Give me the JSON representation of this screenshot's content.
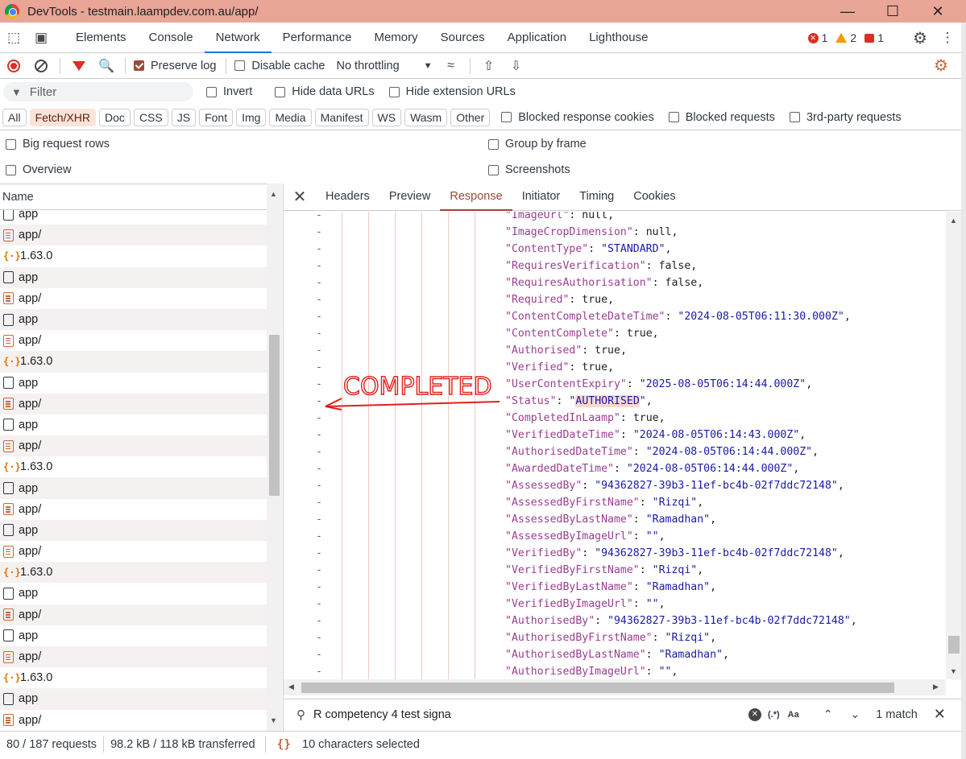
{
  "window": {
    "title": "DevTools - testmain.laampdev.com.au/app/"
  },
  "main_tabs": [
    "Elements",
    "Console",
    "Network",
    "Performance",
    "Memory",
    "Sources",
    "Application",
    "Lighthouse"
  ],
  "active_main_tab": "Network",
  "counters": {
    "errors": "1",
    "warnings": "2",
    "issues": "1"
  },
  "toolbar": {
    "preserve_log": "Preserve log",
    "disable_cache": "Disable cache",
    "throttling": "No throttling"
  },
  "filter": {
    "placeholder": "Filter",
    "invert": "Invert",
    "hide_data_urls": "Hide data URLs",
    "hide_extension_urls": "Hide extension URLs"
  },
  "type_chips": [
    "All",
    "Fetch/XHR",
    "Doc",
    "CSS",
    "JS",
    "Font",
    "Img",
    "Media",
    "Manifest",
    "WS",
    "Wasm",
    "Other"
  ],
  "active_chip": "Fetch/XHR",
  "chip_checks": {
    "blocked_cookies": "Blocked response cookies",
    "blocked_requests": "Blocked requests",
    "third_party": "3rd-party requests"
  },
  "options": {
    "big_rows": "Big request rows",
    "group_by_frame": "Group by frame",
    "overview": "Overview",
    "screenshots": "Screenshots"
  },
  "request_list": {
    "header": "Name",
    "rows": [
      {
        "icon": "doc",
        "name": "app"
      },
      {
        "icon": "lines",
        "name": "app/"
      },
      {
        "icon": "json",
        "name": "1.63.0"
      },
      {
        "icon": "doc",
        "name": "app"
      },
      {
        "icon": "lines",
        "name": "app/"
      },
      {
        "icon": "doc",
        "name": "app"
      },
      {
        "icon": "lines",
        "name": "app/"
      },
      {
        "icon": "json",
        "name": "1.63.0"
      },
      {
        "icon": "doc",
        "name": "app"
      },
      {
        "icon": "lines",
        "name": "app/"
      },
      {
        "icon": "doc",
        "name": "app"
      },
      {
        "icon": "lines",
        "name": "app/"
      },
      {
        "icon": "json",
        "name": "1.63.0"
      },
      {
        "icon": "doc",
        "name": "app"
      },
      {
        "icon": "lines",
        "name": "app/"
      },
      {
        "icon": "doc",
        "name": "app"
      },
      {
        "icon": "lines",
        "name": "app/"
      },
      {
        "icon": "json",
        "name": "1.63.0"
      },
      {
        "icon": "doc",
        "name": "app"
      },
      {
        "icon": "lines",
        "name": "app/"
      },
      {
        "icon": "doc",
        "name": "app"
      },
      {
        "icon": "lines",
        "name": "app/"
      },
      {
        "icon": "json",
        "name": "1.63.0"
      },
      {
        "icon": "doc",
        "name": "app"
      },
      {
        "icon": "lines",
        "name": "app/"
      }
    ]
  },
  "detail_tabs": [
    "Headers",
    "Preview",
    "Response",
    "Initiator",
    "Timing",
    "Cookies"
  ],
  "active_detail_tab": "Response",
  "response_lines": [
    {
      "key": "\"ImageUrl\"",
      "value": "null",
      "type": "p"
    },
    {
      "key": "\"ImageCropDimension\"",
      "value": "null",
      "type": "p"
    },
    {
      "key": "\"ContentType\"",
      "value": "\"STANDARD\"",
      "type": "s"
    },
    {
      "key": "\"RequiresVerification\"",
      "value": "false",
      "type": "p"
    },
    {
      "key": "\"RequiresAuthorisation\"",
      "value": "false",
      "type": "p"
    },
    {
      "key": "\"Required\"",
      "value": "true",
      "type": "p"
    },
    {
      "key": "\"ContentCompleteDateTime\"",
      "value": "\"2024-08-05T06:11:30.000Z\"",
      "type": "s"
    },
    {
      "key": "\"ContentComplete\"",
      "value": "true",
      "type": "p"
    },
    {
      "key": "\"Authorised\"",
      "value": "true",
      "type": "p"
    },
    {
      "key": "\"Verified\"",
      "value": "true",
      "type": "p"
    },
    {
      "key": "\"UserContentExpiry\"",
      "value": "\"2025-08-05T06:14:44.000Z\"",
      "type": "s"
    },
    {
      "key": "\"Status\"",
      "value": "\"AUTHORISED\"",
      "type": "hl"
    },
    {
      "key": "\"CompletedInLaamp\"",
      "value": "true",
      "type": "p"
    },
    {
      "key": "\"VerifiedDateTime\"",
      "value": "\"2024-08-05T06:14:43.000Z\"",
      "type": "s"
    },
    {
      "key": "\"AuthorisedDateTime\"",
      "value": "\"2024-08-05T06:14:44.000Z\"",
      "type": "s"
    },
    {
      "key": "\"AwardedDateTime\"",
      "value": "\"2024-08-05T06:14:44.000Z\"",
      "type": "s"
    },
    {
      "key": "\"AssessedBy\"",
      "value": "\"94362827-39b3-11ef-bc4b-02f7ddc72148\"",
      "type": "s"
    },
    {
      "key": "\"AssessedByFirstName\"",
      "value": "\"Rizqi\"",
      "type": "s"
    },
    {
      "key": "\"AssessedByLastName\"",
      "value": "\"Ramadhan\"",
      "type": "s"
    },
    {
      "key": "\"AssessedByImageUrl\"",
      "value": "\"\"",
      "type": "s"
    },
    {
      "key": "\"VerifiedBy\"",
      "value": "\"94362827-39b3-11ef-bc4b-02f7ddc72148\"",
      "type": "s"
    },
    {
      "key": "\"VerifiedByFirstName\"",
      "value": "\"Rizqi\"",
      "type": "s"
    },
    {
      "key": "\"VerifiedByLastName\"",
      "value": "\"Ramadhan\"",
      "type": "s"
    },
    {
      "key": "\"VerifiedByImageUrl\"",
      "value": "\"\"",
      "type": "s"
    },
    {
      "key": "\"AuthorisedBy\"",
      "value": "\"94362827-39b3-11ef-bc4b-02f7ddc72148\"",
      "type": "s"
    },
    {
      "key": "\"AuthorisedByFirstName\"",
      "value": "\"Rizqi\"",
      "type": "s"
    },
    {
      "key": "\"AuthorisedByLastName\"",
      "value": "\"Ramadhan\"",
      "type": "s"
    },
    {
      "key": "\"AuthorisedByImageUrl\"",
      "value": "\"\"",
      "type": "s"
    }
  ],
  "annotation": {
    "text": "COMPLETED",
    "color": "#e0201a"
  },
  "search": {
    "query": "R competency 4 test signa",
    "match_count": "1 match",
    "regex_label": "(.*)",
    "case_label": "Aa"
  },
  "status": {
    "requests": "80 / 187 requests",
    "transferred": "98.2 kB / 118 kB transferred",
    "selection": "10 characters selected"
  },
  "colors": {
    "accent": "#9b4a37",
    "titlebar": "#e9a596"
  }
}
